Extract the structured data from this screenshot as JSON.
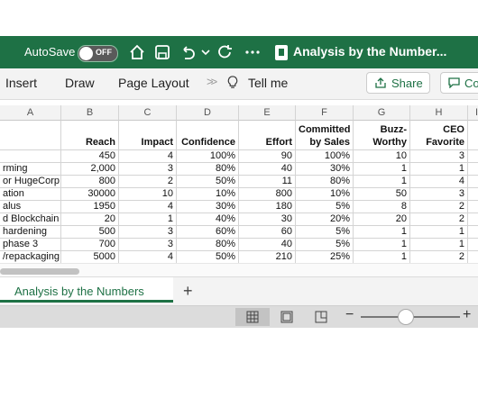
{
  "title_bar": {
    "autosave_label": "AutoSave",
    "autosave_state": "OFF",
    "doc_title": "Analysis by the Number...",
    "icons": [
      "home-icon",
      "save-icon",
      "undo-icon",
      "dropdown-icon",
      "redo-icon",
      "more-icon",
      "excel-doc-icon"
    ],
    "accent_color": "#1e7145"
  },
  "ribbon": {
    "tabs": [
      "Insert",
      "Draw",
      "Page Layout"
    ],
    "overflow_glyph": ">>",
    "tell_me": "Tell me",
    "share_label": "Share",
    "comments_label": "Co"
  },
  "sheet": {
    "columns": [
      "A",
      "B",
      "C",
      "D",
      "E",
      "F",
      "G",
      "H",
      "I"
    ],
    "header_row": {
      "B": [
        "Reach"
      ],
      "C": [
        "Impact"
      ],
      "D": [
        "Confidence"
      ],
      "E": [
        "Effort"
      ],
      "F": [
        "Committed",
        "by Sales"
      ],
      "G": [
        "Buzz-",
        "Worthy"
      ],
      "H": [
        "CEO",
        "Favorite"
      ]
    },
    "rows": [
      [
        "",
        "450",
        "4",
        "100%",
        "90",
        "100%",
        "10",
        "3"
      ],
      [
        "rming",
        "2,000",
        "3",
        "80%",
        "40",
        "30%",
        "1",
        "1"
      ],
      [
        "or HugeCorp",
        "800",
        "2",
        "50%",
        "11",
        "80%",
        "1",
        "4"
      ],
      [
        "ation",
        "30000",
        "10",
        "10%",
        "800",
        "10%",
        "50",
        "3"
      ],
      [
        "alus",
        "1950",
        "4",
        "30%",
        "180",
        "5%",
        "8",
        "2"
      ],
      [
        "d Blockchain",
        "20",
        "1",
        "40%",
        "30",
        "20%",
        "20",
        "2"
      ],
      [
        "hardening",
        "500",
        "3",
        "60%",
        "60",
        "5%",
        "1",
        "1"
      ],
      [
        "phase 3",
        "700",
        "3",
        "80%",
        "40",
        "5%",
        "1",
        "1"
      ],
      [
        "/repackaging",
        "5000",
        "4",
        "50%",
        "210",
        "25%",
        "1",
        "2"
      ]
    ]
  },
  "sheet_tabs": {
    "active": "Analysis by the Numbers",
    "add_glyph": "+"
  },
  "status_bar": {
    "views": [
      "normal-view-icon",
      "page-layout-view-icon",
      "page-break-view-icon"
    ],
    "zoom_minus": "−",
    "zoom_plus": "+",
    "zoom_level_fraction": 0.45
  }
}
